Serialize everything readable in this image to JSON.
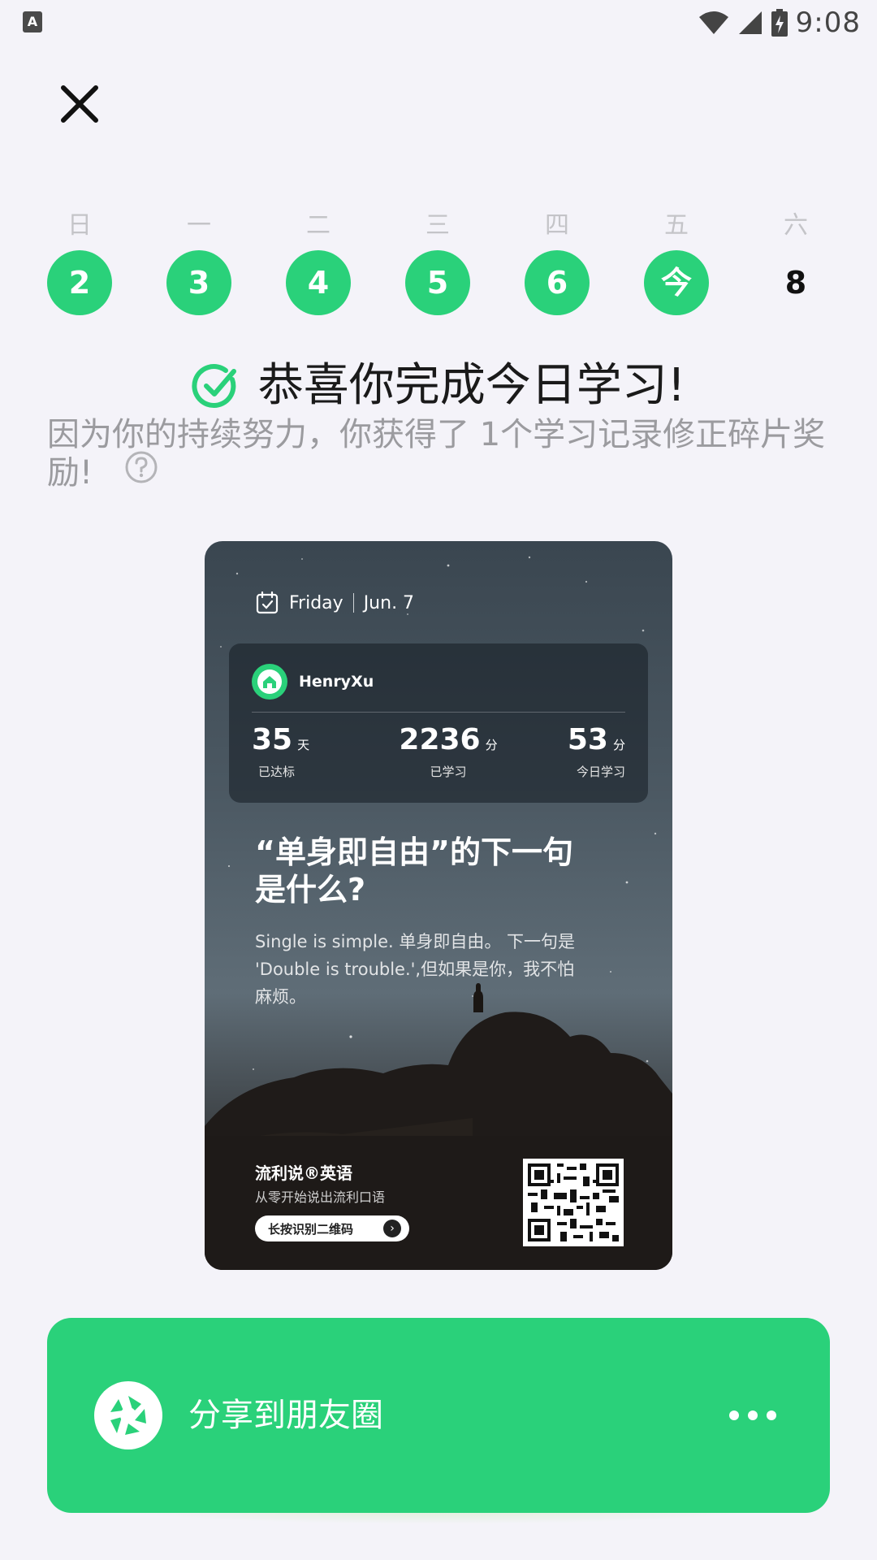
{
  "status_bar": {
    "time": "9:08",
    "app_icon": "A"
  },
  "week": {
    "days": [
      {
        "label": "日",
        "date": "2",
        "done": true
      },
      {
        "label": "一",
        "date": "3",
        "done": true
      },
      {
        "label": "二",
        "date": "4",
        "done": true
      },
      {
        "label": "三",
        "date": "5",
        "done": true
      },
      {
        "label": "四",
        "date": "6",
        "done": true
      },
      {
        "label": "五",
        "date": "今",
        "done": true
      },
      {
        "label": "六",
        "date": "8",
        "done": false
      }
    ]
  },
  "congrats": {
    "title": "恭喜你完成今日学习!",
    "message": "因为你的持续努力，你获得了 1个学习记录修正碎片奖励!"
  },
  "card": {
    "weekday": "Friday",
    "date": "Jun. 7",
    "user_name": "HenryXu",
    "stats": [
      {
        "value": "35",
        "unit": "天",
        "label": "已达标"
      },
      {
        "value": "2236",
        "unit": "分",
        "label": "已学习"
      },
      {
        "value": "53",
        "unit": "分",
        "label": "今日学习"
      }
    ],
    "quote_title": "“单身即自由”的下一句是什么?",
    "quote_body": "Single is simple. 单身即自由。 下一句是 'Double is trouble.',但如果是你，我不怕麻烦。",
    "brand_name": "流利说®英语",
    "brand_slogan": "从零开始说出流利口语",
    "scan_label": "长按识别二维码"
  },
  "share": {
    "label": "分享到朋友圈"
  },
  "colors": {
    "accent": "#2ad17a",
    "background": "#f4f3f9"
  },
  "icons": [
    "close-icon",
    "check-circle-icon",
    "help-icon",
    "calendar-icon",
    "home-icon",
    "moments-shutter-icon",
    "more-icon",
    "wifi-icon",
    "signal-icon",
    "battery-icon"
  ]
}
